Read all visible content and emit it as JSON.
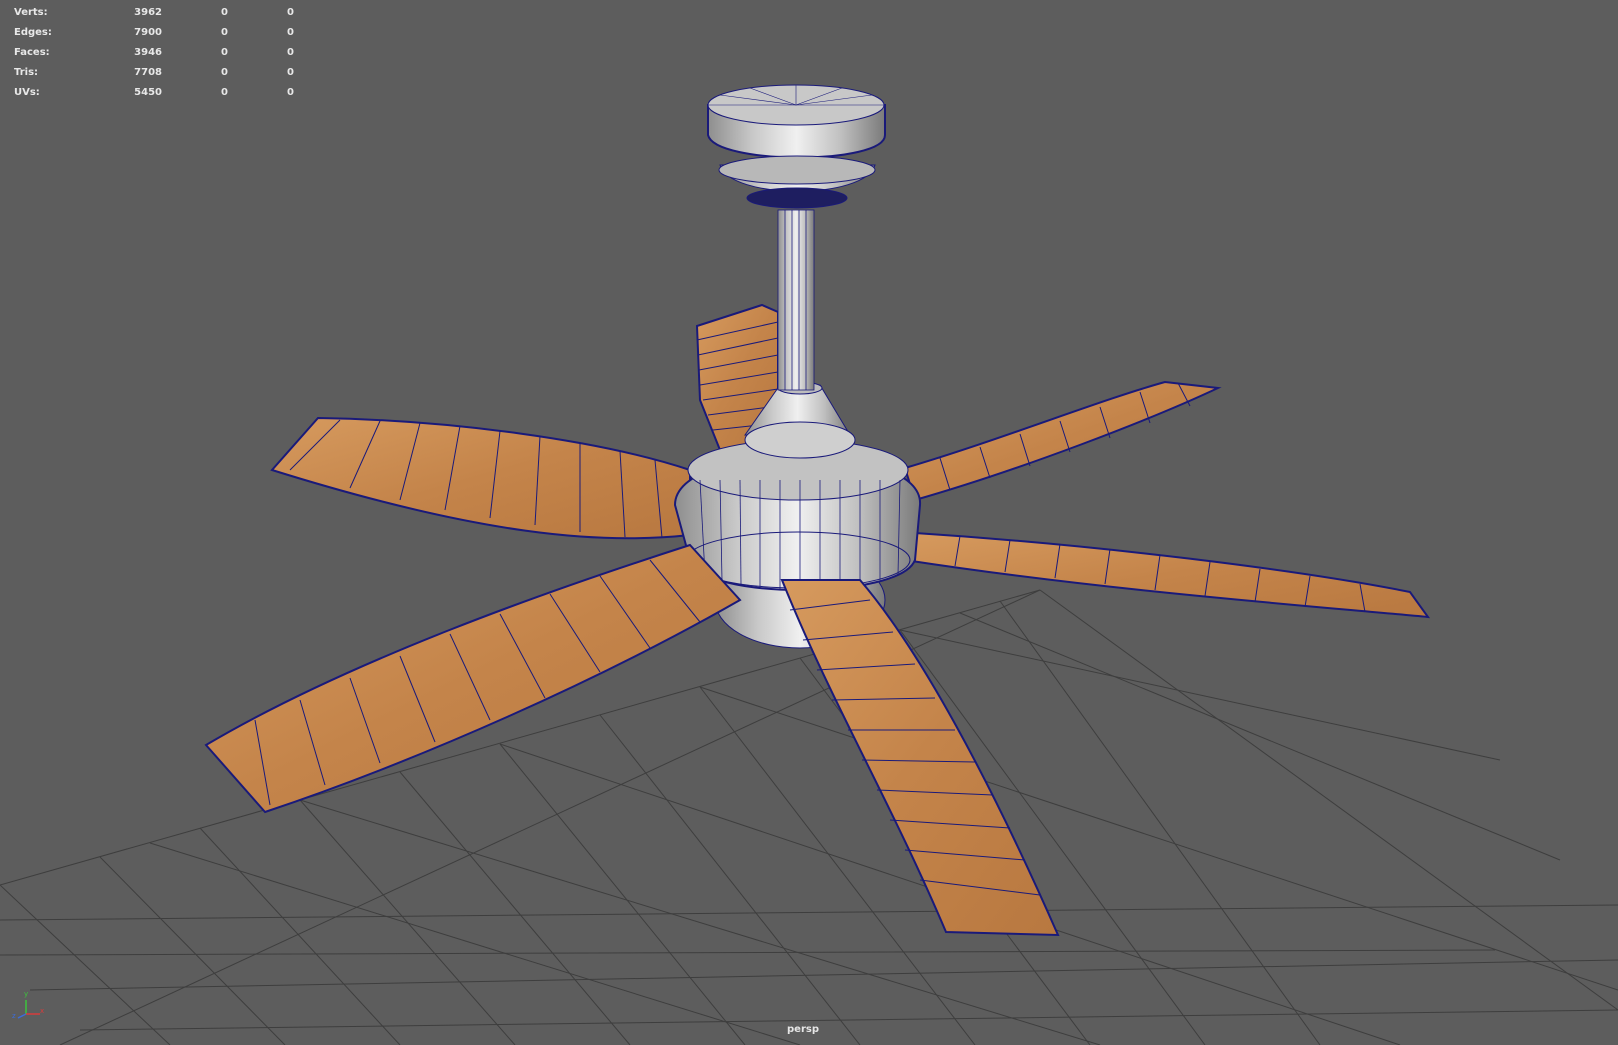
{
  "hud": {
    "rows": [
      {
        "label": "Verts:",
        "v1": "3962",
        "v2": "0",
        "v3": "0"
      },
      {
        "label": "Edges:",
        "v1": "7900",
        "v2": "0",
        "v3": "0"
      },
      {
        "label": "Faces:",
        "v1": "3946",
        "v2": "0",
        "v3": "0"
      },
      {
        "label": "Tris:",
        "v1": "7708",
        "v2": "0",
        "v3": "0"
      },
      {
        "label": "UVs:",
        "v1": "5450",
        "v2": "0",
        "v3": "0"
      }
    ]
  },
  "camera": {
    "label": "persp"
  },
  "axis_gizmo": {
    "x": "x",
    "y": "y",
    "z": "z"
  },
  "colors": {
    "viewport_bg": "#5d5d5d",
    "grid": "#3f3f3f",
    "wireframe": "#1a1a7a",
    "wood": "#c98a50",
    "metal": "#b8b8b8",
    "text": "#e8e8e8"
  }
}
